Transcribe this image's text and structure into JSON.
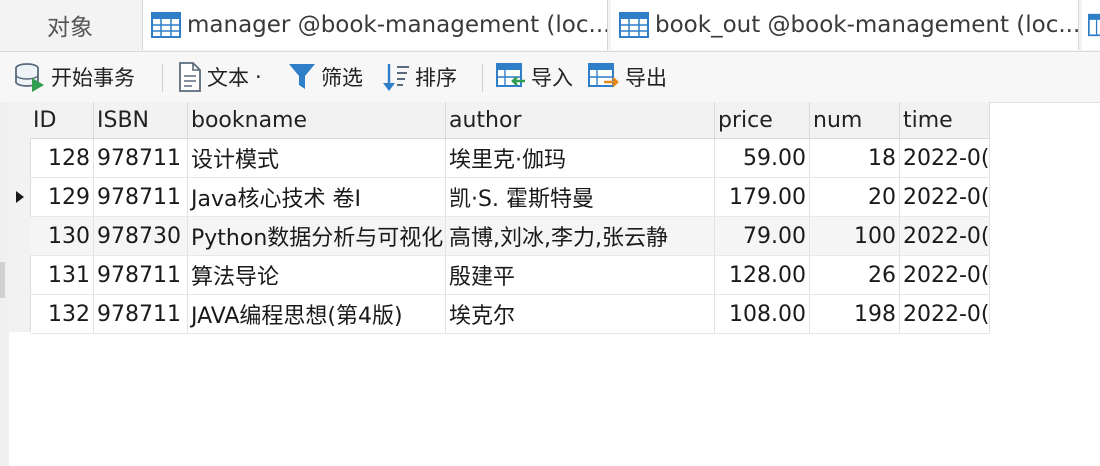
{
  "tabs": {
    "objects_label": "对象",
    "items": [
      {
        "label": "manager @book-management (loc...",
        "icon": "table-icon"
      },
      {
        "label": "book_out @book-management (loc...",
        "icon": "table-icon"
      },
      {
        "label": "",
        "icon": "table-icon"
      }
    ]
  },
  "toolbar": {
    "begin_transaction": "开始事务",
    "text": "文本",
    "text_dropdown": "·",
    "filter": "筛选",
    "sort": "排序",
    "import": "导入",
    "export": "导出"
  },
  "grid": {
    "columns": [
      "ID",
      "ISBN",
      "bookname",
      "author",
      "price",
      "num",
      "time"
    ],
    "current_row_index": 1,
    "rows": [
      {
        "ID": "128",
        "ISBN": "978711",
        "bookname": "设计模式",
        "author": "埃里克·伽玛",
        "price": "59.00",
        "num": "18",
        "time": "2022-0("
      },
      {
        "ID": "129",
        "ISBN": "978711",
        "bookname": "Java核心技术 卷I",
        "author": "凯·S. 霍斯特曼",
        "price": "179.00",
        "num": "20",
        "time": "2022-0("
      },
      {
        "ID": "130",
        "ISBN": "978730",
        "bookname": "Python数据分析与可视化",
        "author": "高博,刘冰,李力,张云静",
        "price": "79.00",
        "num": "100",
        "time": "2022-0("
      },
      {
        "ID": "131",
        "ISBN": "978711",
        "bookname": "算法导论",
        "author": "殷建平",
        "price": "128.00",
        "num": "26",
        "time": "2022-0("
      },
      {
        "ID": "132",
        "ISBN": "978711",
        "bookname": "JAVA编程思想(第4版)",
        "author": " 埃克尔",
        "price": "108.00",
        "num": "198",
        "time": "2022-0("
      }
    ]
  },
  "colors": {
    "row_highlight": "#f5f5f5",
    "icon_blue": "#2f7fc8",
    "icon_green": "#2f9e4f",
    "icon_orange": "#e88a1a"
  }
}
